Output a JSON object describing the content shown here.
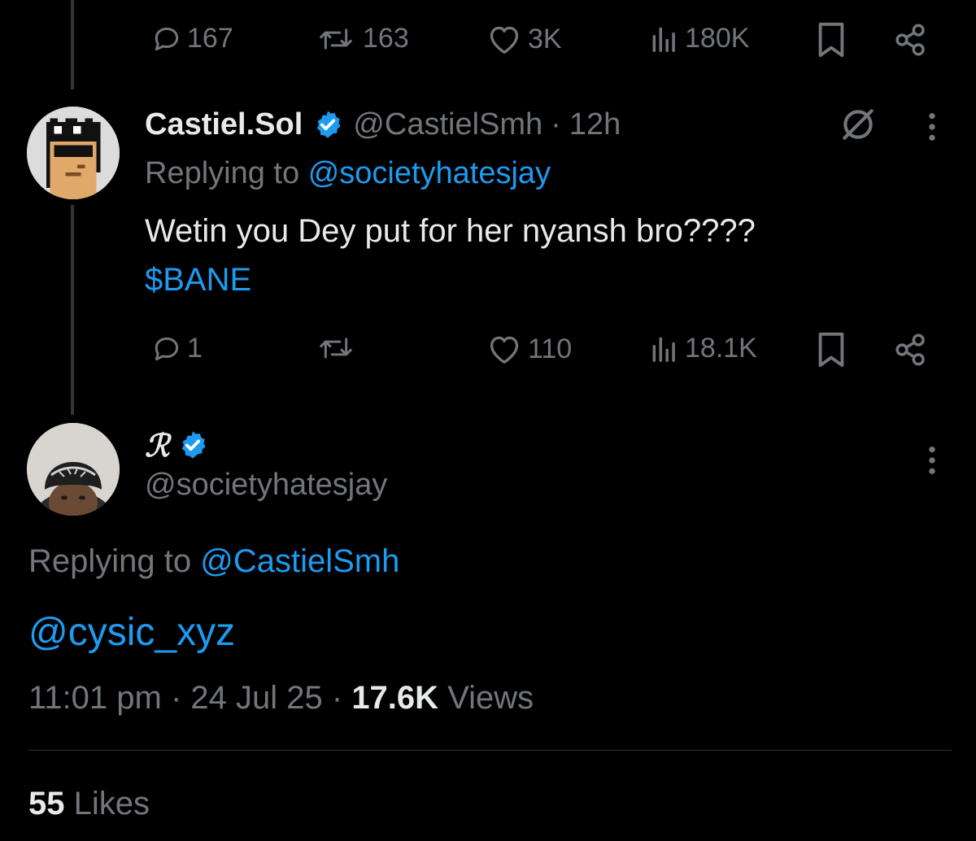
{
  "tweet_top": {
    "replies": "167",
    "retweets": "163",
    "likes": "3K",
    "views": "180K"
  },
  "reply1": {
    "display_name": "Castiel.Sol",
    "handle": "@CastielSmh",
    "separator": "·",
    "time": "12h",
    "replying_prefix": "Replying to",
    "replying_handle": "@societyhatesjay",
    "text": "Wetin you Dey put for her nyansh bro????",
    "cashtag": "$BANE",
    "replies": "1",
    "retweets": "",
    "likes": "110",
    "views": "18.1K"
  },
  "main": {
    "display_name": "ℛ",
    "handle": "@societyhatesjay",
    "replying_prefix": "Replying to",
    "replying_handle": "@CastielSmh",
    "text": "@cysic_xyz",
    "time": "11:01 pm",
    "sep1": "·",
    "date": "24 Jul 25",
    "sep2": "·",
    "views_count": "17.6K",
    "views_label": "Views",
    "likes_count": "55",
    "likes_label": "Likes"
  },
  "colors": {
    "background": "#000000",
    "text": "#e7e9ea",
    "secondary": "#71767b",
    "accent": "#1d9bf0"
  },
  "icons": [
    "reply-icon",
    "retweet-icon",
    "like-icon",
    "views-icon",
    "bookmark-icon",
    "share-icon",
    "verified-icon",
    "grok-icon",
    "more-icon"
  ]
}
